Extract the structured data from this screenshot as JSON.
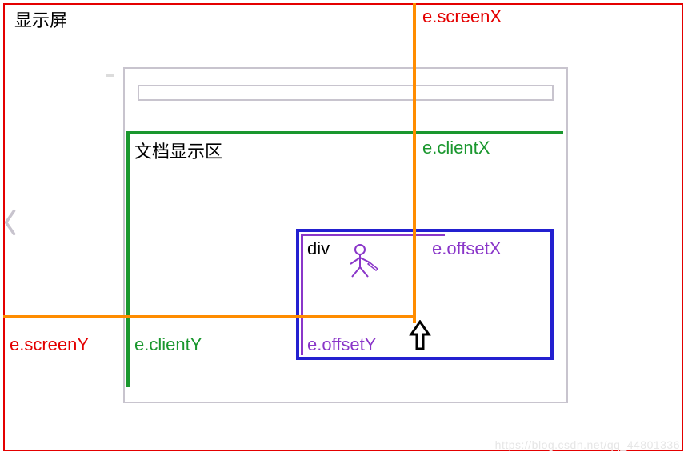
{
  "screen": {
    "label": "显示屏"
  },
  "client": {
    "label": "文档显示区"
  },
  "div": {
    "label": "div"
  },
  "labels": {
    "screenX": "e.screenX",
    "screenY": "e.screenY",
    "clientX": "e.clientX",
    "clientY": "e.clientY",
    "offsetX": "e.offsetX",
    "offsetY": "e.offsetY"
  },
  "watermark": "https://blog.csdn.net/qq_44801336"
}
